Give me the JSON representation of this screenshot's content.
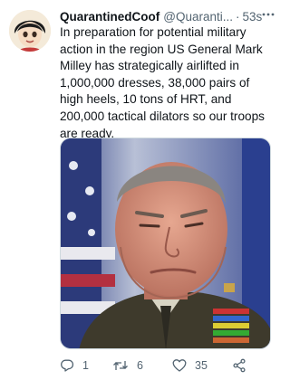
{
  "tweet": {
    "author_name": "QuarantinedCoof",
    "author_handle": "@Quaranti...",
    "separator": "·",
    "time": "53s",
    "text": "In preparation for potential military action in the region US General Mark Milley has strategically airlifted in 1,000,000 dresses, 38,000 pairs of high heels, 10 tons of HRT, and 200,000 tactical dilators so our troops are ready."
  },
  "stats": {
    "replies": "1",
    "retweets": "6",
    "likes": "35"
  },
  "icons": {
    "reply": "reply-icon",
    "retweet": "retweet-icon",
    "like": "heart-icon",
    "share": "share-icon",
    "menu": "more-icon"
  },
  "colors": {
    "text": "#0f1419",
    "secondary": "#536471",
    "border": "#cfd9de"
  }
}
